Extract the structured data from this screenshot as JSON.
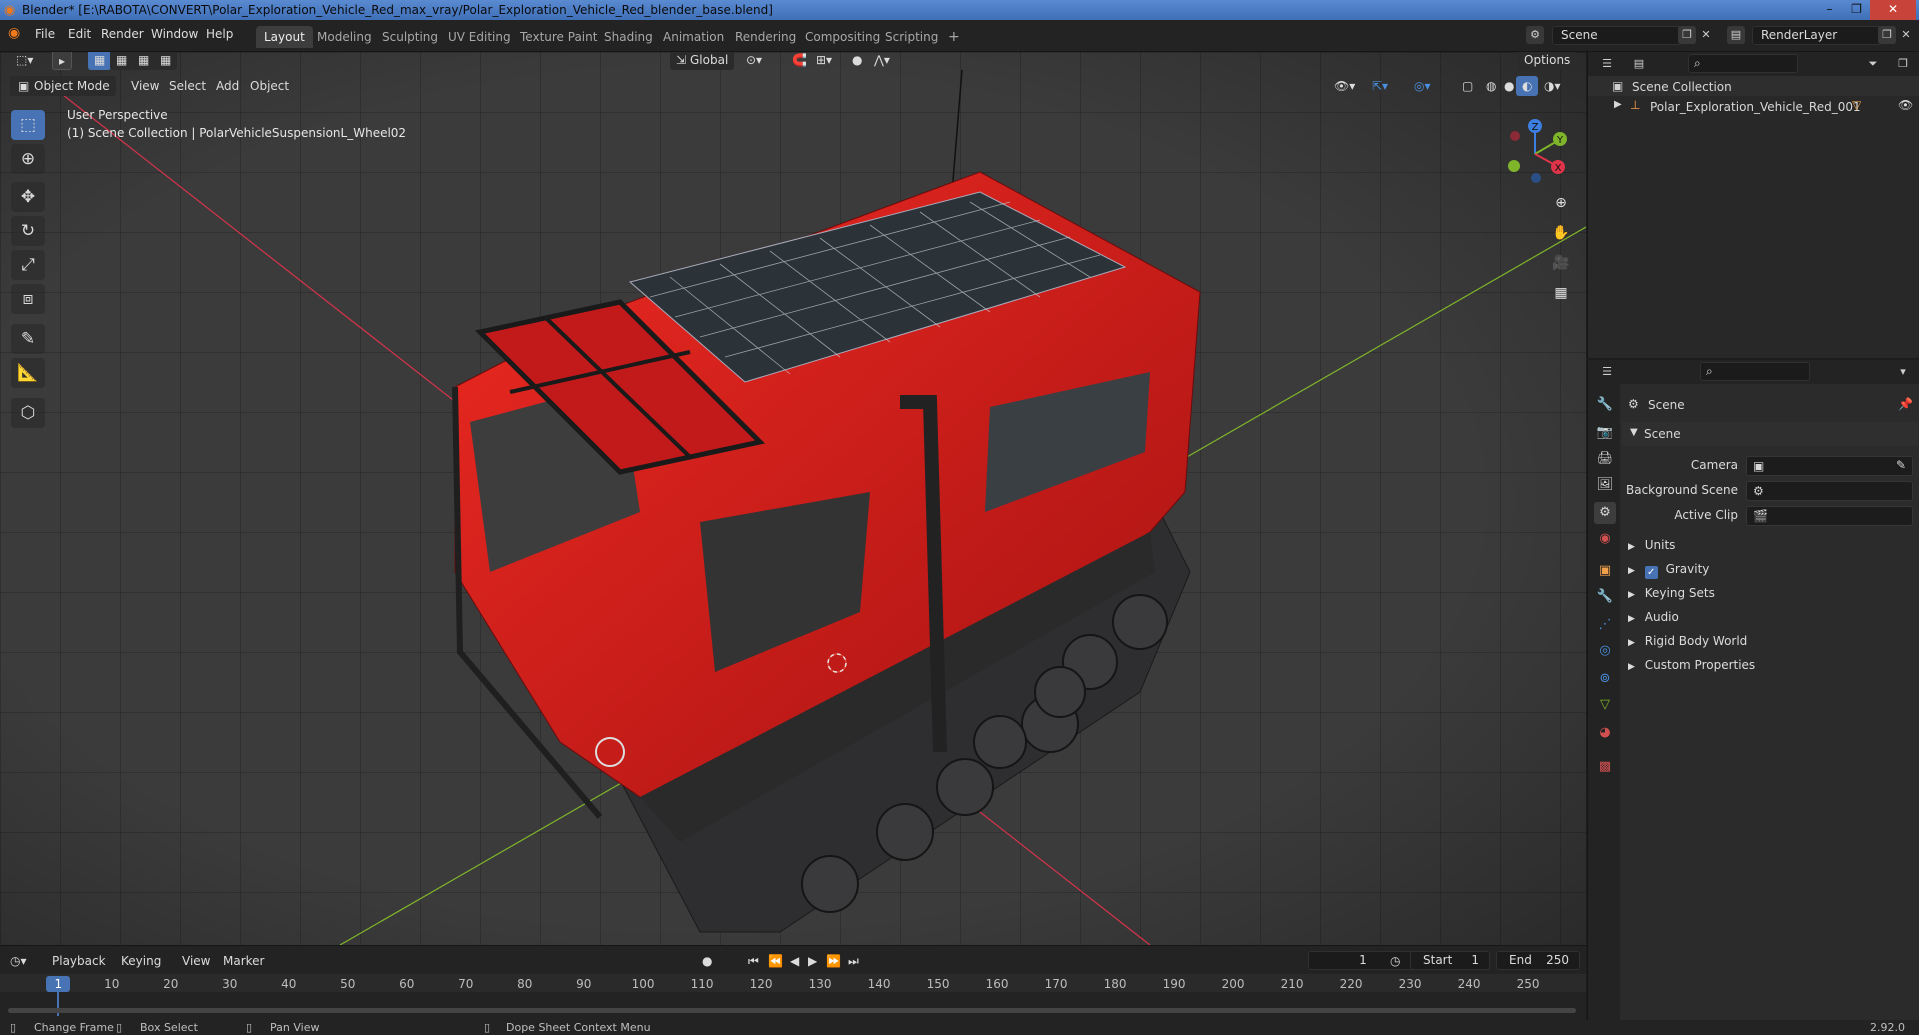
{
  "window": {
    "title": "Blender* [E:\\RABOTA\\CONVERT\\Polar_Exploration_Vehicle_Red_max_vray/Polar_Exploration_Vehicle_Red_blender_base.blend]",
    "controls": [
      "–",
      "❐",
      "✕"
    ]
  },
  "menu": [
    "File",
    "Edit",
    "Render",
    "Window",
    "Help"
  ],
  "workspaces": [
    "Layout",
    "Modeling",
    "Sculpting",
    "UV Editing",
    "Texture Paint",
    "Shading",
    "Animation",
    "Rendering",
    "Compositing",
    "Scripting"
  ],
  "workspace_add": "+",
  "scene_field": "Scene",
  "renderlayer_field": "RenderLayer",
  "viewport": {
    "mode": "Object Mode",
    "menus": [
      "View",
      "Select",
      "Add",
      "Object"
    ],
    "transform_orientation": "Global",
    "options": "Options",
    "perspective": "User Perspective",
    "collection_info": "(1) Scene Collection | PolarVehicleSuspensionL_Wheel02",
    "gizmo": {
      "z": "Z",
      "y": "Y",
      "x": "X"
    }
  },
  "colors": {
    "accent": "#4772b3",
    "vehicle_red": "#d91c1c",
    "x_axis": "#e0344a",
    "y_axis": "#7fb52a",
    "z_axis": "#3c7fe0"
  },
  "outliner": {
    "root": "Scene Collection",
    "items": [
      {
        "label": "Polar_Exploration_Vehicle_Red_001"
      }
    ]
  },
  "properties": {
    "context": "Scene",
    "section": "Scene",
    "fields": [
      {
        "label": "Camera"
      },
      {
        "label": "Background Scene"
      },
      {
        "label": "Active Clip"
      }
    ],
    "panels": [
      {
        "label": "Units",
        "checkbox": false
      },
      {
        "label": "Gravity",
        "checkbox": true
      },
      {
        "label": "Keying Sets",
        "checkbox": false
      },
      {
        "label": "Audio",
        "checkbox": false
      },
      {
        "label": "Rigid Body World",
        "checkbox": false
      },
      {
        "label": "Custom Properties",
        "checkbox": false
      }
    ]
  },
  "timeline": {
    "menus": [
      "Playback",
      "Keying",
      "View",
      "Marker"
    ],
    "current_frame": "1",
    "start_label": "Start",
    "start": "1",
    "end_label": "End",
    "end": "250",
    "ticks": [
      "1",
      "10",
      "20",
      "30",
      "40",
      "50",
      "60",
      "70",
      "80",
      "90",
      "100",
      "110",
      "120",
      "130",
      "140",
      "150",
      "160",
      "170",
      "180",
      "190",
      "200",
      "210",
      "220",
      "230",
      "240",
      "250"
    ]
  },
  "status": {
    "items": [
      "Change Frame",
      "Box Select",
      "Pan View",
      "Dope Sheet Context Menu"
    ],
    "version": "2.92.0"
  }
}
